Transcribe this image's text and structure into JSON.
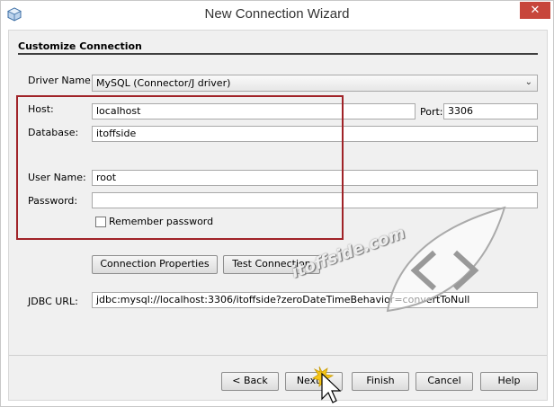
{
  "window": {
    "title": "New Connection Wizard",
    "close_label": "✕"
  },
  "section": {
    "title": "Customize Connection"
  },
  "form": {
    "driver_label": "Driver Name:",
    "driver_value": "MySQL (Connector/J driver)",
    "host_label": "Host:",
    "host_value": "localhost",
    "port_label": "Port:",
    "port_value": "3306",
    "database_label": "Database:",
    "database_value": "itoffside",
    "username_label": "User Name:",
    "username_value": "root",
    "password_label": "Password:",
    "password_value": "",
    "remember_label": "Remember password",
    "remember_checked": false,
    "jdbc_label": "JDBC URL:",
    "jdbc_value": "jdbc:mysql://localhost:3306/itoffside?zeroDateTimeBehavior=convertToNull"
  },
  "actions": {
    "connection_properties": "Connection Properties",
    "test_connection": "Test Connection"
  },
  "footer": {
    "back": "< Back",
    "next": "Next >",
    "finish": "Finish",
    "cancel": "Cancel",
    "help": "Help"
  },
  "watermark": {
    "text": "itoffside.com"
  },
  "colors": {
    "highlight": "#a02328",
    "close": "#c7463b"
  }
}
